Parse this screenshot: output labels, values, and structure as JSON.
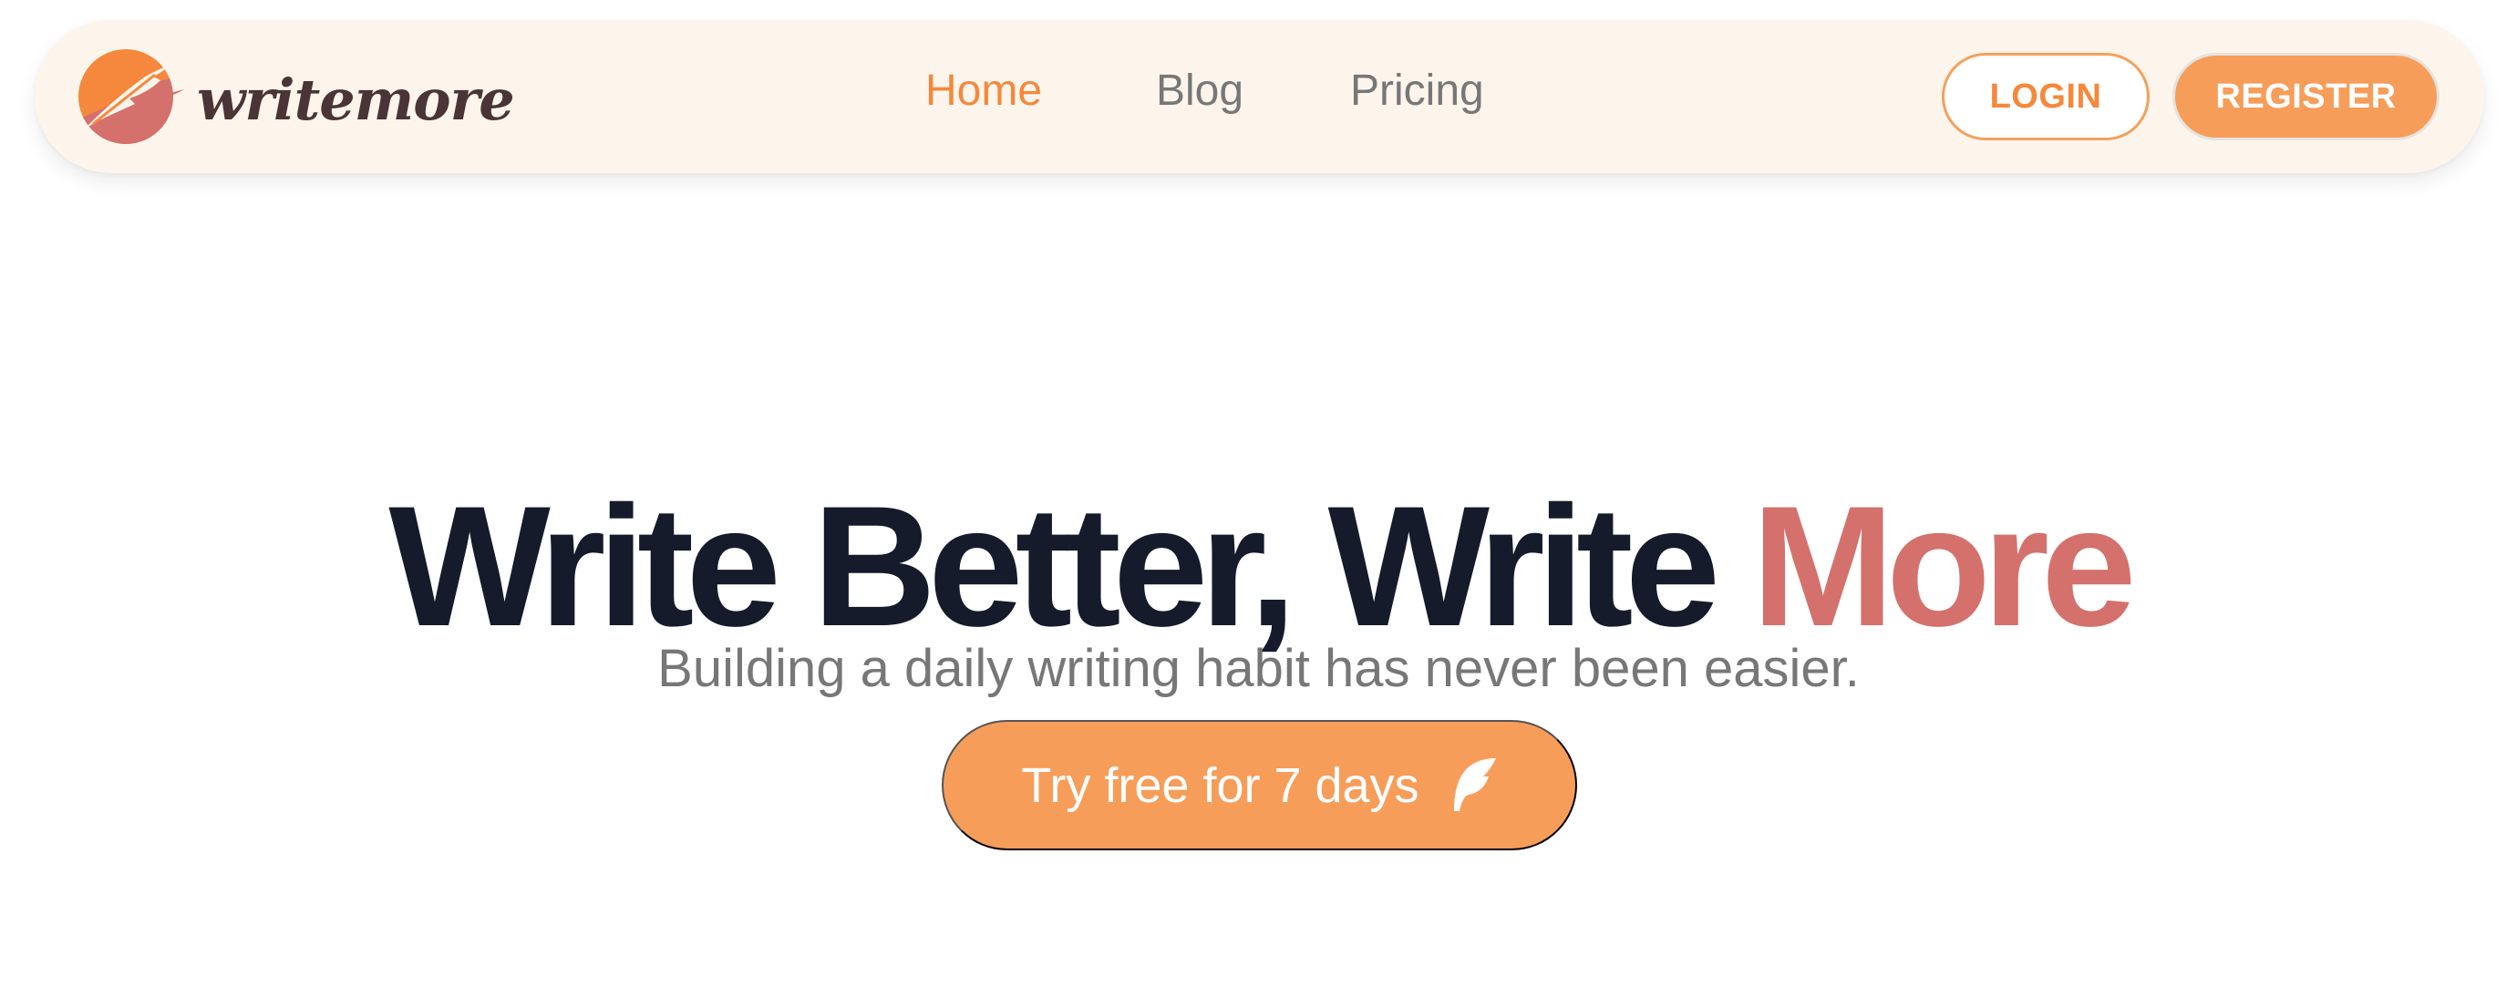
{
  "brand": {
    "name": "writemore",
    "logo_icon": "feather-circle-logo-icon",
    "colors": {
      "orange": "#f5883c",
      "peach": "#f79d5a",
      "rose": "#d4716c",
      "navy": "#151b2b",
      "cream": "#fdf5ec",
      "brown": "#4a3436",
      "gray": "#777777"
    }
  },
  "nav": {
    "links": [
      {
        "label": "Home",
        "active": true
      },
      {
        "label": "Blog",
        "active": false
      },
      {
        "label": "Pricing",
        "active": false
      }
    ],
    "login_label": "LOGIN",
    "register_label": "REGISTER"
  },
  "hero": {
    "title_main": "Write Better, Write ",
    "title_accent": "More",
    "subtitle": "Building a daily writing habit has never been easier.",
    "cta_label": "Try free for 7 days",
    "cta_icon": "feather-icon"
  }
}
